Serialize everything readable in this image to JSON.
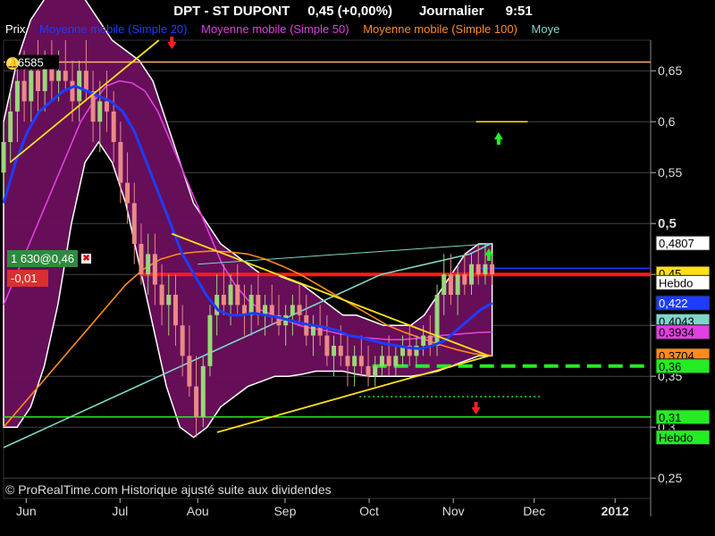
{
  "header": {
    "symbol": "DPT - ST DUPONT",
    "quote": "0,45 (+0,00%)",
    "period": "Journalier",
    "time": "9:51"
  },
  "legend": [
    {
      "label": "Prix",
      "color": "#ffffff"
    },
    {
      "label": "Moyenne mobile (Simple 20)",
      "color": "#1e3cff"
    },
    {
      "label": "Moyenne mobile (Simple 50)",
      "color": "#e040e0"
    },
    {
      "label": "Moyenne mobile (Simple 100)",
      "color": "#ff8c1a"
    },
    {
      "label": "Moye",
      "color": "#7fd6c8"
    }
  ],
  "copyright": "© ProRealTime.com Historique ajusté suite aux dividendes",
  "position_box": {
    "size_price": "1 630@0,46",
    "pnl": "-0,01",
    "close_icon": "close-icon"
  },
  "colors": {
    "background": "#000000",
    "bollinger_fill": "#6b0f5c",
    "candle_up": "#9cd67a",
    "candle_down": "#e98a86",
    "ma20": "#1e3cff",
    "ma50": "#e040e0",
    "ma100": "#ff8c1a",
    "ma200": "#7fd6c8",
    "trendline": "#ffe01a",
    "support_red": "#ff1a1a",
    "support_green": "#22ee22"
  },
  "chart_data": {
    "type": "candlestick",
    "title": "DPT - ST DUPONT",
    "x_ticks": [
      "Jun",
      "Jul",
      "Aou",
      "Sep",
      "Oct",
      "Nov",
      "Dec",
      "2012"
    ],
    "y_ticks": [
      "0,25",
      "0,3",
      "0,35",
      "0,4",
      "0,45",
      "0,5",
      "0,55",
      "0,6",
      "0,65"
    ],
    "ylim": [
      0.23,
      0.68
    ],
    "grid": true,
    "price_labels": [
      {
        "text": "0,6585",
        "value": 0.6585,
        "side": "left",
        "bg": "#000000",
        "fg": "#ffffff"
      },
      {
        "text": "0,4807",
        "value": 0.4807,
        "side": "right",
        "bg": "#ffffff",
        "fg": "#000000"
      },
      {
        "text": "0,45",
        "value": 0.45,
        "side": "right",
        "bg": "#ff1a1a",
        "fg": "#ffffff"
      },
      {
        "text": "0,45",
        "value": 0.451,
        "side": "right",
        "bg": "#ffe01a",
        "fg": "#000000"
      },
      {
        "text": "Hebdo",
        "value": 0.442,
        "side": "right",
        "bg": "#ffffff",
        "fg": "#000000"
      },
      {
        "text": "0,422",
        "value": 0.422,
        "side": "right",
        "bg": "#1e3cff",
        "fg": "#ffffff"
      },
      {
        "text": "0,4043",
        "value": 0.4043,
        "side": "right",
        "bg": "#7fd6c8",
        "fg": "#000000"
      },
      {
        "text": "0,3934",
        "value": 0.3934,
        "side": "right",
        "bg": "#e040e0",
        "fg": "#000000"
      },
      {
        "text": "0,3704",
        "value": 0.3704,
        "side": "right",
        "bg": "#ff8c1a",
        "fg": "#000000"
      },
      {
        "text": "0,36",
        "value": 0.36,
        "side": "right",
        "bg": "#22ee22",
        "fg": "#000000"
      },
      {
        "text": "0,31",
        "value": 0.31,
        "side": "right",
        "bg": "#22ee22",
        "fg": "#000000"
      },
      {
        "text": "Hebdo",
        "value": 0.29,
        "side": "right",
        "bg": "#22ee22",
        "fg": "#000000"
      }
    ],
    "horizontal_lines": [
      {
        "name": "resistance-0.6585",
        "value": 0.6585,
        "color": "#ffb070",
        "style": "solid"
      },
      {
        "name": "red-support-0.45",
        "value": 0.45,
        "color": "#ff1a1a",
        "style": "solid",
        "from": 0.21
      },
      {
        "name": "blue-level-0.456",
        "value": 0.456,
        "color": "#1e3cff",
        "style": "solid",
        "from": 0.73
      },
      {
        "name": "green-support-0.36",
        "value": 0.36,
        "color": "#22ee22",
        "style": "dashed",
        "from": 0.57
      },
      {
        "name": "green-target-0.33",
        "value": 0.33,
        "color": "#22ee22",
        "style": "dotted",
        "from": 0.55,
        "to": 0.83
      },
      {
        "name": "weekly-support-0.31",
        "value": 0.31,
        "color": "#22ee22",
        "style": "solid"
      },
      {
        "name": "yellow-target-0.6",
        "value": 0.6,
        "color": "#ffe01a",
        "style": "solid",
        "from": 0.73,
        "to": 0.81
      }
    ],
    "candles": [
      {
        "o": 0.55,
        "h": 0.6,
        "l": 0.52,
        "c": 0.58
      },
      {
        "o": 0.58,
        "h": 0.63,
        "l": 0.56,
        "c": 0.61
      },
      {
        "o": 0.61,
        "h": 0.66,
        "l": 0.58,
        "c": 0.64
      },
      {
        "o": 0.64,
        "h": 0.67,
        "l": 0.6,
        "c": 0.62
      },
      {
        "o": 0.62,
        "h": 0.66,
        "l": 0.6,
        "c": 0.65
      },
      {
        "o": 0.65,
        "h": 0.68,
        "l": 0.61,
        "c": 0.63
      },
      {
        "o": 0.63,
        "h": 0.67,
        "l": 0.61,
        "c": 0.66
      },
      {
        "o": 0.66,
        "h": 0.68,
        "l": 0.62,
        "c": 0.64
      },
      {
        "o": 0.64,
        "h": 0.67,
        "l": 0.62,
        "c": 0.65
      },
      {
        "o": 0.65,
        "h": 0.68,
        "l": 0.63,
        "c": 0.64
      },
      {
        "o": 0.64,
        "h": 0.66,
        "l": 0.6,
        "c": 0.62
      },
      {
        "o": 0.62,
        "h": 0.66,
        "l": 0.6,
        "c": 0.65
      },
      {
        "o": 0.65,
        "h": 0.68,
        "l": 0.62,
        "c": 0.63
      },
      {
        "o": 0.63,
        "h": 0.65,
        "l": 0.58,
        "c": 0.6
      },
      {
        "o": 0.6,
        "h": 0.64,
        "l": 0.57,
        "c": 0.62
      },
      {
        "o": 0.62,
        "h": 0.65,
        "l": 0.59,
        "c": 0.61
      },
      {
        "o": 0.61,
        "h": 0.63,
        "l": 0.56,
        "c": 0.58
      },
      {
        "o": 0.58,
        "h": 0.6,
        "l": 0.52,
        "c": 0.54
      },
      {
        "o": 0.54,
        "h": 0.57,
        "l": 0.5,
        "c": 0.52
      },
      {
        "o": 0.52,
        "h": 0.54,
        "l": 0.46,
        "c": 0.48
      },
      {
        "o": 0.48,
        "h": 0.5,
        "l": 0.44,
        "c": 0.45
      },
      {
        "o": 0.45,
        "h": 0.49,
        "l": 0.43,
        "c": 0.47
      },
      {
        "o": 0.47,
        "h": 0.49,
        "l": 0.42,
        "c": 0.44
      },
      {
        "o": 0.44,
        "h": 0.46,
        "l": 0.4,
        "c": 0.42
      },
      {
        "o": 0.42,
        "h": 0.45,
        "l": 0.39,
        "c": 0.43
      },
      {
        "o": 0.43,
        "h": 0.45,
        "l": 0.38,
        "c": 0.4
      },
      {
        "o": 0.4,
        "h": 0.42,
        "l": 0.35,
        "c": 0.37
      },
      {
        "o": 0.37,
        "h": 0.4,
        "l": 0.33,
        "c": 0.34
      },
      {
        "o": 0.34,
        "h": 0.37,
        "l": 0.29,
        "c": 0.31
      },
      {
        "o": 0.31,
        "h": 0.37,
        "l": 0.3,
        "c": 0.36
      },
      {
        "o": 0.36,
        "h": 0.42,
        "l": 0.35,
        "c": 0.41
      },
      {
        "o": 0.41,
        "h": 0.45,
        "l": 0.39,
        "c": 0.43
      },
      {
        "o": 0.43,
        "h": 0.46,
        "l": 0.41,
        "c": 0.42
      },
      {
        "o": 0.42,
        "h": 0.45,
        "l": 0.4,
        "c": 0.44
      },
      {
        "o": 0.44,
        "h": 0.46,
        "l": 0.41,
        "c": 0.42
      },
      {
        "o": 0.42,
        "h": 0.44,
        "l": 0.39,
        "c": 0.41
      },
      {
        "o": 0.41,
        "h": 0.44,
        "l": 0.39,
        "c": 0.43
      },
      {
        "o": 0.43,
        "h": 0.45,
        "l": 0.4,
        "c": 0.41
      },
      {
        "o": 0.41,
        "h": 0.43,
        "l": 0.39,
        "c": 0.42
      },
      {
        "o": 0.42,
        "h": 0.44,
        "l": 0.4,
        "c": 0.41
      },
      {
        "o": 0.41,
        "h": 0.43,
        "l": 0.39,
        "c": 0.4
      },
      {
        "o": 0.4,
        "h": 0.42,
        "l": 0.38,
        "c": 0.41
      },
      {
        "o": 0.41,
        "h": 0.43,
        "l": 0.39,
        "c": 0.42
      },
      {
        "o": 0.42,
        "h": 0.44,
        "l": 0.4,
        "c": 0.41
      },
      {
        "o": 0.41,
        "h": 0.43,
        "l": 0.38,
        "c": 0.39
      },
      {
        "o": 0.39,
        "h": 0.41,
        "l": 0.37,
        "c": 0.4
      },
      {
        "o": 0.4,
        "h": 0.42,
        "l": 0.38,
        "c": 0.39
      },
      {
        "o": 0.39,
        "h": 0.41,
        "l": 0.36,
        "c": 0.37
      },
      {
        "o": 0.37,
        "h": 0.39,
        "l": 0.35,
        "c": 0.38
      },
      {
        "o": 0.38,
        "h": 0.4,
        "l": 0.36,
        "c": 0.37
      },
      {
        "o": 0.37,
        "h": 0.39,
        "l": 0.34,
        "c": 0.36
      },
      {
        "o": 0.36,
        "h": 0.38,
        "l": 0.34,
        "c": 0.37
      },
      {
        "o": 0.37,
        "h": 0.39,
        "l": 0.35,
        "c": 0.36
      },
      {
        "o": 0.36,
        "h": 0.38,
        "l": 0.34,
        "c": 0.35
      },
      {
        "o": 0.35,
        "h": 0.37,
        "l": 0.34,
        "c": 0.36
      },
      {
        "o": 0.36,
        "h": 0.38,
        "l": 0.35,
        "c": 0.37
      },
      {
        "o": 0.37,
        "h": 0.39,
        "l": 0.35,
        "c": 0.36
      },
      {
        "o": 0.36,
        "h": 0.38,
        "l": 0.35,
        "c": 0.37
      },
      {
        "o": 0.37,
        "h": 0.39,
        "l": 0.36,
        "c": 0.38
      },
      {
        "o": 0.38,
        "h": 0.4,
        "l": 0.36,
        "c": 0.37
      },
      {
        "o": 0.37,
        "h": 0.39,
        "l": 0.36,
        "c": 0.38
      },
      {
        "o": 0.38,
        "h": 0.4,
        "l": 0.37,
        "c": 0.39
      },
      {
        "o": 0.39,
        "h": 0.41,
        "l": 0.37,
        "c": 0.38
      },
      {
        "o": 0.38,
        "h": 0.44,
        "l": 0.37,
        "c": 0.43
      },
      {
        "o": 0.43,
        "h": 0.47,
        "l": 0.41,
        "c": 0.45
      },
      {
        "o": 0.45,
        "h": 0.47,
        "l": 0.42,
        "c": 0.43
      },
      {
        "o": 0.43,
        "h": 0.46,
        "l": 0.41,
        "c": 0.45
      },
      {
        "o": 0.45,
        "h": 0.47,
        "l": 0.43,
        "c": 0.44
      },
      {
        "o": 0.44,
        "h": 0.47,
        "l": 0.43,
        "c": 0.46
      },
      {
        "o": 0.46,
        "h": 0.48,
        "l": 0.44,
        "c": 0.45
      },
      {
        "o": 0.45,
        "h": 0.48,
        "l": 0.44,
        "c": 0.46
      },
      {
        "o": 0.46,
        "h": 0.47,
        "l": 0.44,
        "c": 0.45
      }
    ],
    "ma20": [
      0.52,
      0.56,
      0.59,
      0.61,
      0.62,
      0.63,
      0.635,
      0.63,
      0.625,
      0.62,
      0.61,
      0.59,
      0.56,
      0.53,
      0.5,
      0.47,
      0.45,
      0.43,
      0.415,
      0.41,
      0.41,
      0.412,
      0.41,
      0.408,
      0.405,
      0.402,
      0.4,
      0.398,
      0.395,
      0.39,
      0.388,
      0.385,
      0.382,
      0.38,
      0.378,
      0.377,
      0.38,
      0.385,
      0.395,
      0.405,
      0.415,
      0.422
    ],
    "ma50": [
      0.42,
      0.45,
      0.48,
      0.51,
      0.54,
      0.57,
      0.6,
      0.62,
      0.635,
      0.64,
      0.638,
      0.63,
      0.61,
      0.58,
      0.55,
      0.52,
      0.49,
      0.46,
      0.44,
      0.425,
      0.415,
      0.41,
      0.405,
      0.4,
      0.397,
      0.395,
      0.392,
      0.39,
      0.388,
      0.387,
      0.386,
      0.386,
      0.387,
      0.388,
      0.39,
      0.391,
      0.392,
      0.393,
      0.3934
    ],
    "ma100": [
      0.3,
      0.32,
      0.34,
      0.36,
      0.38,
      0.4,
      0.42,
      0.44,
      0.455,
      0.465,
      0.47,
      0.472,
      0.473,
      0.472,
      0.47,
      0.465,
      0.458,
      0.45,
      0.44,
      0.43,
      0.42,
      0.41,
      0.4,
      0.393,
      0.387,
      0.381,
      0.376,
      0.372,
      0.3704
    ],
    "ma200": [
      0.28,
      0.29,
      0.3,
      0.31,
      0.32,
      0.33,
      0.34,
      0.35,
      0.36,
      0.37,
      0.38,
      0.39,
      0.4,
      0.41,
      0.42,
      0.43,
      0.44,
      0.45,
      0.455,
      0.46,
      0.465,
      0.47,
      0.4807
    ],
    "bb_upper": [
      0.6,
      0.66,
      0.7,
      0.72,
      0.73,
      0.73,
      0.72,
      0.7,
      0.68,
      0.67,
      0.66,
      0.64,
      0.6,
      0.56,
      0.52,
      0.5,
      0.48,
      0.47,
      0.46,
      0.45,
      0.45,
      0.445,
      0.44,
      0.43,
      0.42,
      0.41,
      0.41,
      0.405,
      0.4,
      0.4,
      0.4,
      0.41,
      0.43,
      0.45,
      0.47,
      0.48,
      0.48
    ],
    "bb_lower": [
      0.3,
      0.3,
      0.32,
      0.36,
      0.42,
      0.5,
      0.56,
      0.58,
      0.56,
      0.52,
      0.46,
      0.4,
      0.34,
      0.3,
      0.29,
      0.3,
      0.32,
      0.33,
      0.34,
      0.345,
      0.35,
      0.35,
      0.352,
      0.355,
      0.355,
      0.355,
      0.352,
      0.35,
      0.35,
      0.35,
      0.35,
      0.352,
      0.355,
      0.36,
      0.365,
      0.37,
      0.37
    ],
    "trendlines": [
      {
        "name": "yellow-uptrend-early",
        "x": [
          0.01,
          0.24
        ],
        "y": [
          0.56,
          0.68
        ]
      },
      {
        "name": "yellow-downtrend",
        "x": [
          0.26,
          0.75
        ],
        "y": [
          0.49,
          0.37
        ]
      },
      {
        "name": "yellow-uptrend-low",
        "x": [
          0.33,
          0.75
        ],
        "y": [
          0.295,
          0.37
        ]
      },
      {
        "name": "ma200-channel-upper",
        "x": [
          0.3,
          0.75
        ],
        "y": [
          0.46,
          0.48
        ]
      }
    ]
  }
}
